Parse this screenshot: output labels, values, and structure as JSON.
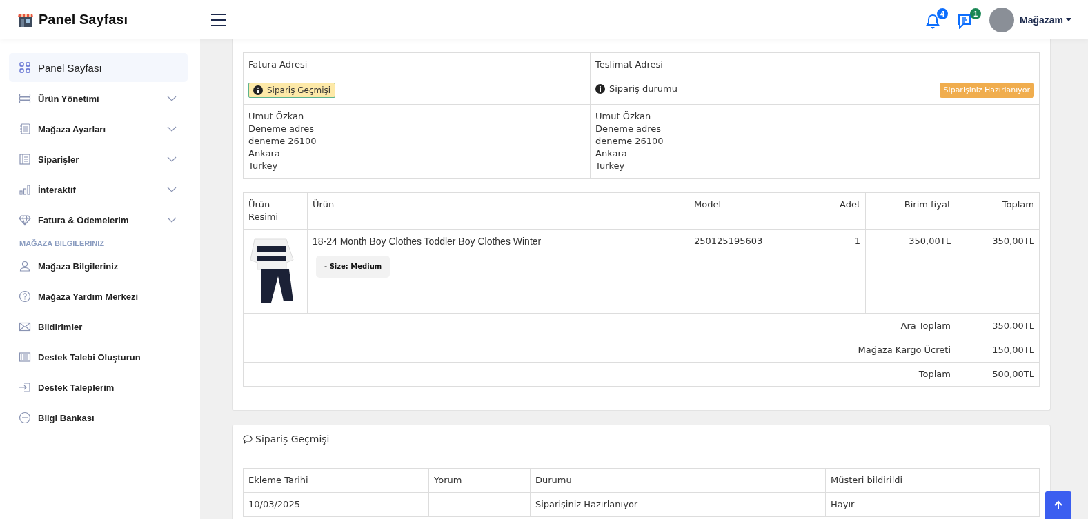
{
  "header": {
    "brand": "Panel Sayfası",
    "notifications": "4",
    "messages": "1",
    "user": "Mağazam"
  },
  "sidebar": {
    "items": [
      {
        "kind": "item",
        "label": "Panel Sayfası",
        "selected": true,
        "expandable": false
      },
      {
        "kind": "item",
        "label": "Ürün Yönetimi",
        "selected": false,
        "expandable": true
      },
      {
        "kind": "item",
        "label": "Mağaza Ayarları",
        "selected": false,
        "expandable": true
      },
      {
        "kind": "item",
        "label": "Siparişler",
        "selected": false,
        "expandable": true
      },
      {
        "kind": "item",
        "label": "İnteraktif",
        "selected": false,
        "expandable": true
      },
      {
        "kind": "item",
        "label": "Fatura & Ödemelerim",
        "selected": false,
        "expandable": true
      },
      {
        "kind": "heading",
        "label": "MAĞAZA BILGILERINIZ"
      },
      {
        "kind": "item",
        "label": "Mağaza Bilgileriniz",
        "selected": false,
        "expandable": false
      },
      {
        "kind": "item",
        "label": "Mağaza Yardım Merkezi",
        "selected": false,
        "expandable": false
      },
      {
        "kind": "item",
        "label": "Bildirimler",
        "selected": false,
        "expandable": false
      },
      {
        "kind": "item",
        "label": "Destek Talebi Oluşturun",
        "selected": false,
        "expandable": false
      },
      {
        "kind": "item",
        "label": "Destek Taleplerim",
        "selected": false,
        "expandable": false
      },
      {
        "kind": "item",
        "label": "Bilgi Bankası",
        "selected": false,
        "expandable": false
      }
    ]
  },
  "order": {
    "billing": {
      "heading": "Fatura Adresi",
      "badge": "Sipariş Geçmişi",
      "lines": [
        "Umut Özkan",
        "Deneme adres",
        "deneme 26100",
        "Ankara",
        "Turkey"
      ]
    },
    "shipping": {
      "heading": "Teslimat Adresi",
      "status_label": "Sipariş durumu",
      "lines": [
        "Umut Özkan",
        "Deneme adres",
        "deneme 26100",
        "Ankara",
        "Turkey"
      ]
    },
    "status_badge": "Siparişiniz Hazırlanıyor",
    "products": {
      "columns": [
        "Ürün Resimi",
        "Ürün",
        "Model",
        "Adet",
        "Birim fiyat",
        "Toplam"
      ],
      "rows": [
        {
          "name": "18-24 Month Boy Clothes Toddler Boy Clothes Winter",
          "option": "- Size: Medium",
          "model": "250125195603",
          "quantity": "1",
          "unit_price": "350,00TL",
          "total": "350,00TL"
        }
      ],
      "totals": [
        {
          "label": "Ara Toplam",
          "value": "350,00TL"
        },
        {
          "label": "Mağaza Kargo Ücreti",
          "value": "150,00TL"
        },
        {
          "label": "Toplam",
          "value": "500,00TL"
        }
      ]
    }
  },
  "history": {
    "title": "Sipariş Geçmişi",
    "columns": [
      "Ekleme Tarihi",
      "Yorum",
      "Durumu",
      "Müşteri bildirildi"
    ],
    "rows": [
      [
        "10/03/2025",
        "",
        "Siparişiniz Hazırlanıyor",
        "Hayır"
      ]
    ]
  }
}
